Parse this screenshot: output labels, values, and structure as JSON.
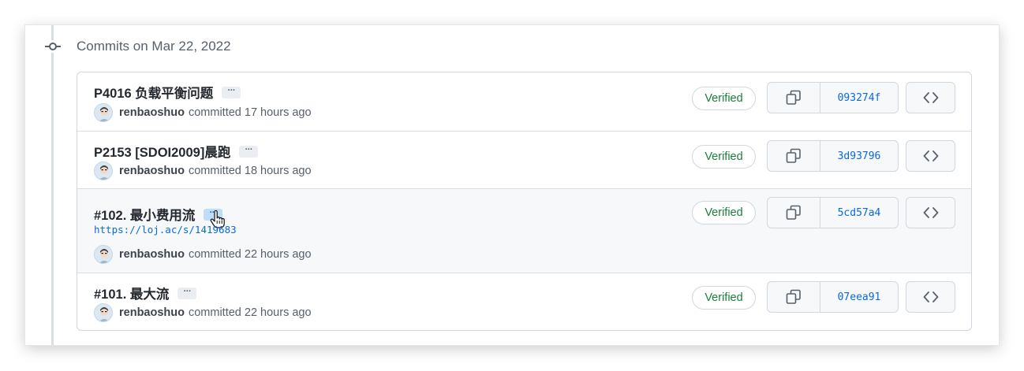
{
  "day_header": "Commits on Mar 22, 2022",
  "ellipsis_label": "···",
  "verified_label": "Verified",
  "icons": {
    "commit": "git-commit-icon",
    "copy": "copy-icon",
    "browse": "code-icon",
    "cursor": "hand-pointer-icon"
  },
  "colors": {
    "verified_text": "#1a7f37",
    "sha_link": "#0969da",
    "hover_row": "#f6f8fa",
    "active_ellipsis": "#bfdcf9"
  },
  "commits": [
    {
      "title": "P4016 负载平衡问题",
      "author": "renbaoshuo",
      "committed": "committed 17 hours ago",
      "sha": "093274f"
    },
    {
      "title": "P2153 [SDOI2009]晨跑",
      "author": "renbaoshuo",
      "committed": "committed 18 hours ago",
      "sha": "3d93796"
    },
    {
      "title": "#102. 最小费用流",
      "body": "https://loj.ac/s/1419683",
      "author": "renbaoshuo",
      "committed": "committed 22 hours ago",
      "sha": "5cd57a4"
    },
    {
      "title": "#101. 最大流",
      "author": "renbaoshuo",
      "committed": "committed 22 hours ago",
      "sha": "07eea91"
    }
  ]
}
